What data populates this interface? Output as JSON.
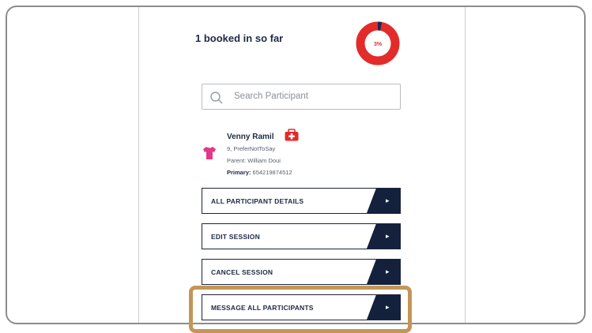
{
  "header": {
    "booked_text": "1 booked in so far",
    "progress_percent_label": "3%",
    "progress_fraction": 0.03
  },
  "search": {
    "placeholder": "Search Participant"
  },
  "participant": {
    "name": "Venny Ramil",
    "gender_line": "9, PreferNotToSay",
    "parent_line": "Parent: William Doui",
    "primary_label": "Primary:",
    "primary_value": "654219874512"
  },
  "actions": {
    "all_details": "ALL PARTICIPANT DETAILS",
    "edit_session": "EDIT SESSION",
    "cancel_session": "CANCEL SESSION",
    "message_all": "MESSAGE ALL PARTICIPANTS"
  },
  "colors": {
    "accent_red": "#e32b2b",
    "navy": "#14213d",
    "highlight": "#c39657",
    "shirt": "#e0388a"
  },
  "icons": {
    "search": "search-icon",
    "medical": "medical-kit-icon",
    "shirt": "t-shirt-icon",
    "arrow": "chevron-right-icon"
  }
}
